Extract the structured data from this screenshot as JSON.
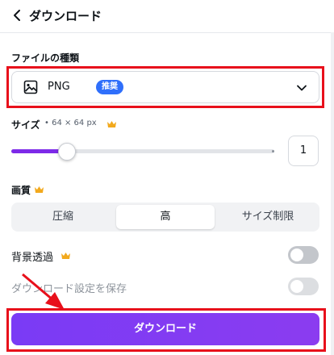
{
  "header": {
    "title": "ダウンロード",
    "back_icon": "chevron-left-icon"
  },
  "file_type": {
    "label": "ファイルの種類",
    "selected": "PNG",
    "badge": "推奨",
    "icon": "image-icon",
    "badge_color": "#2f6ffb"
  },
  "size": {
    "label": "サイズ",
    "meta": "• 64 × 64 px",
    "scale_value": "1",
    "slider_fraction": 0.21
  },
  "quality": {
    "label": "画質",
    "options": [
      "圧縮",
      "高",
      "サイズ制限"
    ],
    "selected": "高"
  },
  "transparent_bg": {
    "label": "背景透過",
    "enabled": false
  },
  "save_settings": {
    "label": "ダウンロード設定を保存",
    "enabled": false
  },
  "download_button": {
    "label": "ダウンロード",
    "color": "#7d2ae8"
  },
  "colors": {
    "highlight_red": "#e8101b",
    "accent_purple": "#7d2ae8",
    "premium_gold": "#f2a91d"
  }
}
